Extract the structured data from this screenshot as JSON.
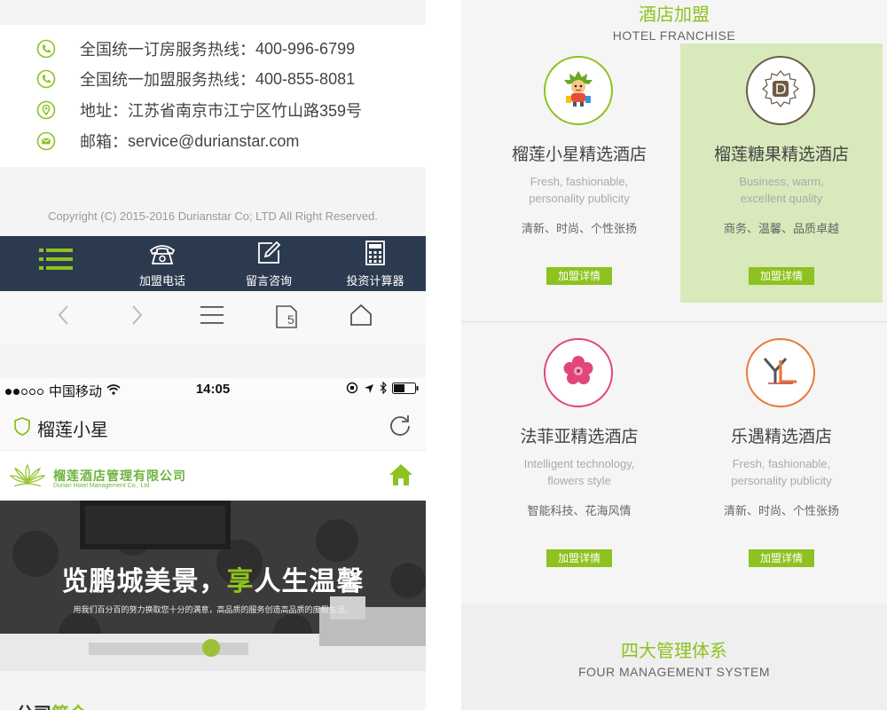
{
  "contact": {
    "items": [
      {
        "label": "全国统一订房服务热线：",
        "value": "400-996-6799",
        "icon": "phone-icon"
      },
      {
        "label": "全国统一加盟服务热线：",
        "value": "400-855-8081",
        "icon": "phone-icon"
      },
      {
        "label": "地址：",
        "value": "江苏省南京市江宁区竹山路359号",
        "icon": "location-icon"
      },
      {
        "label": "邮箱：",
        "value": "service@durianstar.com",
        "icon": "mail-icon"
      }
    ],
    "copyright": "Copyright (C) 2015-2016 Durianstar Co; LTD All Right Reserved."
  },
  "tabbar": {
    "items": [
      {
        "label": "",
        "icon": "menu-icon"
      },
      {
        "label": "加盟电话",
        "icon": "telephone-icon"
      },
      {
        "label": "留言咨询",
        "icon": "edit-icon"
      },
      {
        "label": "投资计算器",
        "icon": "calculator-icon"
      }
    ]
  },
  "browser": {
    "tab_count": "5",
    "carrier": "中国移动",
    "time": "14:05",
    "page_title": "榴莲小星"
  },
  "site": {
    "logo_cn": "榴莲酒店管理有限公司",
    "logo_en": "Durian Hotel Management Co., Ltd.",
    "banner_title_a": "览鹏城美景，",
    "banner_title_b": "享",
    "banner_title_c": "人生温馨",
    "banner_sub": "用我们百分百的努力换取您十分的满意，高品质的服务创造高品质的度假生活。",
    "intro_a": "公司",
    "intro_b": "简介"
  },
  "franchise": {
    "title": "酒店加盟",
    "subtitle": "HOTEL FRANCHISE",
    "cards": [
      {
        "name": "榴莲小星精选酒店",
        "en1": "Fresh, fashionable,",
        "en2": "personality publicity",
        "cn": "清新、时尚、个性张扬",
        "button": "加盟详情",
        "highlighted": false
      },
      {
        "name": "榴莲糖果精选酒店",
        "en1": "Business, warm,",
        "en2": "excellent quality",
        "cn": "商务、温馨、品质卓越",
        "button": "加盟详情",
        "highlighted": true
      },
      {
        "name": "法菲亚精选酒店",
        "en1": "Intelligent technology,",
        "en2": "flowers style",
        "cn": "智能科技、花海风情",
        "button": "加盟详情",
        "highlighted": false
      },
      {
        "name": "乐遇精选酒店",
        "en1": "Fresh, fashionable,",
        "en2": "personality publicity",
        "cn": "清新、时尚、个性张扬",
        "button": "加盟详情",
        "highlighted": false
      }
    ]
  },
  "management": {
    "title": "四大管理体系",
    "subtitle": "FOUR MANAGEMENT SYSTEM"
  },
  "colors": {
    "accent_green": "#8dc21f",
    "tabbar_navy": "#2c3a4f",
    "highlight_card": "#d8e9bb",
    "badge_pink": "#e0457b",
    "badge_orange": "#e8783a"
  }
}
